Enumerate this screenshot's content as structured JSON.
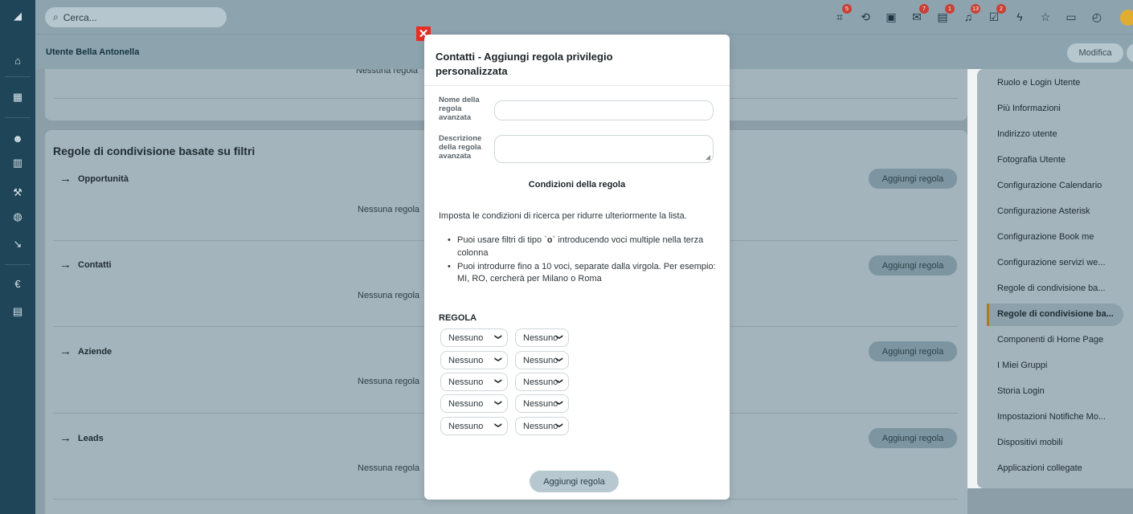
{
  "search": {
    "placeholder": "Cerca..."
  },
  "topbar": {
    "icons": [
      {
        "name": "hierarchy-icon",
        "glyph": "⌗",
        "badge": "5"
      },
      {
        "name": "history-icon",
        "glyph": "⟲",
        "badge": ""
      },
      {
        "name": "calendar-icon",
        "glyph": "▣",
        "badge": ""
      },
      {
        "name": "mail-icon",
        "glyph": "✉",
        "badge": "7"
      },
      {
        "name": "chat-icon",
        "glyph": "▤",
        "badge": "1"
      },
      {
        "name": "bell-icon",
        "glyph": "♫",
        "badge": "13"
      },
      {
        "name": "task-icon",
        "glyph": "☑",
        "badge": "2"
      },
      {
        "name": "flash-icon",
        "glyph": "ϟ",
        "badge": ""
      },
      {
        "name": "star-icon",
        "glyph": "☆",
        "badge": ""
      },
      {
        "name": "document-icon",
        "glyph": "▭",
        "badge": ""
      },
      {
        "name": "timer-icon",
        "glyph": "◴",
        "badge": ""
      }
    ]
  },
  "header": {
    "user_name": "Utente Bella Antonella",
    "edit_label": "Modifica"
  },
  "background": {
    "top_no_rule": "Nessuna regola",
    "section_title": "Regole di condivisione basate su filtri",
    "rows": [
      {
        "label": "Opportunità",
        "empty": "Nessuna regola",
        "add": "Aggiungi regola"
      },
      {
        "label": "Contatti",
        "empty": "Nessuna regola",
        "add": "Aggiungi regola"
      },
      {
        "label": "Aziende",
        "empty": "Nessuna regola",
        "add": "Aggiungi regola"
      },
      {
        "label": "Leads",
        "empty": "Nessuna regola",
        "add": "Aggiungi regola"
      }
    ]
  },
  "right_panel": {
    "items": [
      "Ruolo e Login Utente",
      "Più Informazioni",
      "Indirizzo utente",
      "Fotografia Utente",
      "Configurazione Calendario",
      "Configurazione Asterisk",
      "Configurazione Book me",
      "Configurazione servizi we...",
      "Regole di condivisione ba...",
      "Regole di condivisione ba...",
      "Componenti di Home Page",
      "I Miei Gruppi",
      "Storia Login",
      "Impostazioni Notifiche Mo...",
      "Dispositivi mobili",
      "Applicazioni collegate"
    ],
    "active_index": 9
  },
  "modal": {
    "close_glyph": "✕",
    "title": "Contatti - Aggiungi regola privilegio personalizzata",
    "name_label": "Nome della regola avanzata",
    "name_value": "",
    "desc_label": "Descrizione della regola avanzata",
    "desc_value": "",
    "conditions_title": "Condizioni della regola",
    "intro": "Imposta le condizioni di ricerca per ridurre ulteriormente la lista.",
    "bullet1_a": "Puoi usare filtri di tipo `",
    "bullet1_code": "o",
    "bullet1_b": "` introducendo voci multiple nella terza colonna",
    "bullet2": "Puoi introdurre fino a 10 voci, separate dalla virgola. Per esempio: MI, RO, cercherà per Milano o Roma",
    "rule_label": "REGOLA",
    "rules": [
      {
        "field": "Nessuno",
        "operator": "Nessuno"
      },
      {
        "field": "Nessuno",
        "operator": "Nessuno"
      },
      {
        "field": "Nessuno",
        "operator": "Nessuno"
      },
      {
        "field": "Nessuno",
        "operator": "Nessuno"
      },
      {
        "field": "Nessuno",
        "operator": "Nessuno"
      }
    ],
    "submit_label": "Aggiungi regola"
  },
  "colors": {
    "rail": "#1f4558",
    "overlay": "#8da4af",
    "close": "#e62e25",
    "badge": "#c94136",
    "active_bar": "#b07a16"
  }
}
